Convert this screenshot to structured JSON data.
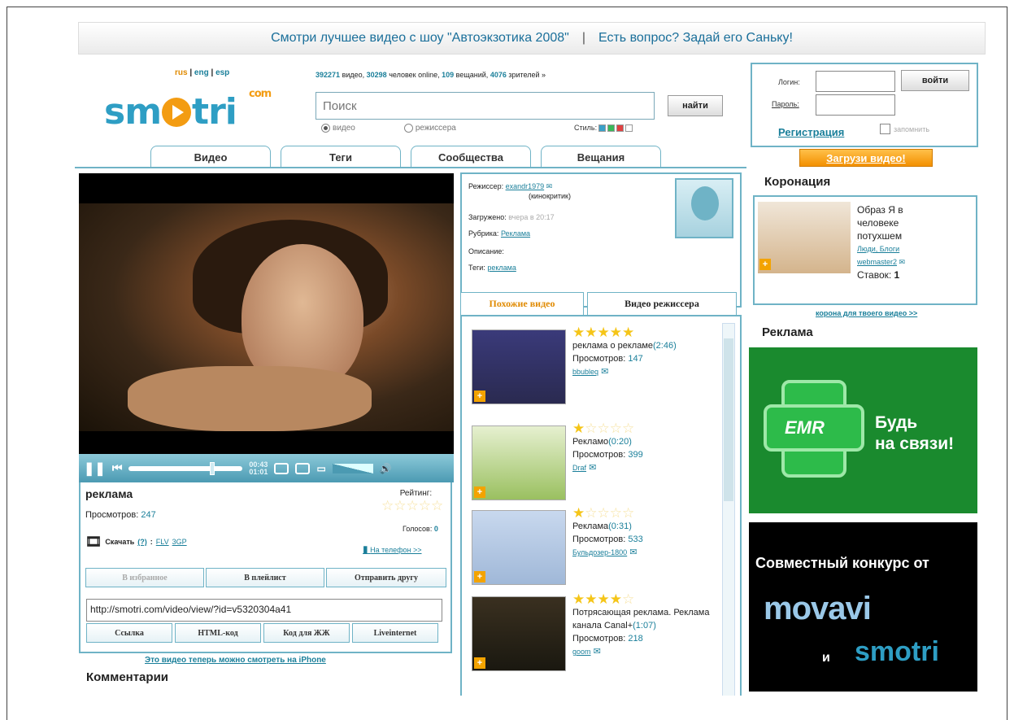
{
  "banner": {
    "left": "Смотри лучшее видео с шоу \"Автоэкзотика 2008\"",
    "sep": "|",
    "right": "Есть вопрос? Задай его Саньку!"
  },
  "langs": [
    "rus",
    "eng",
    "esp"
  ],
  "logo": {
    "text": "sm",
    "text2": "tri",
    "com": "com"
  },
  "stats": {
    "videos": "392271",
    "videos_lbl": "видео,",
    "online": "30298",
    "online_lbl": "человек online,",
    "casts": "109",
    "casts_lbl": "вещаний,",
    "viewers": "4076",
    "viewers_lbl": "зрителей »"
  },
  "search": {
    "placeholder": "Поиск",
    "button": "найти",
    "opt1": "видео",
    "opt2": "режиссера",
    "style_label": "Стиль:"
  },
  "login": {
    "login_label": "Логин:",
    "password_label": "Пароль:",
    "submit": "войти",
    "register": "Регистрация",
    "remember": "запомнить"
  },
  "upload": "Загрузи видео!",
  "tabs": [
    "Видео",
    "Теги",
    "Сообщества",
    "Вещания"
  ],
  "player": {
    "time_current": "00:43",
    "time_total": "01:01"
  },
  "video": {
    "title": "реклама",
    "views_label": "Просмотров:",
    "views": "247",
    "rating_label": "Рейтинг:",
    "votes_label": "Голосов:",
    "votes": "0",
    "download": "Скачать",
    "download_q": "(?)",
    "flv": "FLV",
    "3gp": "3GP",
    "phone": "На телефон >>",
    "btn_fav": "В избранное",
    "btn_playlist": "В плейлист",
    "btn_send": "Отправить другу",
    "url": "http://smotri.com/video/view/?id=v5320304a41",
    "btn_link": "Ссылка",
    "btn_html": "HTML-код",
    "btn_lj": "Код для ЖЖ",
    "btn_li": "Liveinternet"
  },
  "iphone_note": "Это видео теперь можно смотреть на iPhone",
  "comments_title": "Комментарии",
  "director": {
    "label": "Режиссер:",
    "name": "exandr1979",
    "role": "(кинокритик)",
    "uploaded_label": "Загружено:",
    "uploaded": "вчера в 20:17",
    "rubric_label": "Рубрика:",
    "rubric": "Реклама",
    "desc_label": "Описание:",
    "tags_label": "Теги:",
    "tags": "реклама"
  },
  "vtabs": [
    "Похожие видео",
    "Видео режиссера"
  ],
  "similar": [
    {
      "title": "реклама о рекламе",
      "dur": "(2:46)",
      "views_label": "Просмотров:",
      "views": "147",
      "user": "bbubleq",
      "stars": 5
    },
    {
      "title": "Рекламо",
      "dur": "(0:20)",
      "views_label": "Просмотров:",
      "views": "399",
      "user": "Draf",
      "stars": 1
    },
    {
      "title": "Реклама",
      "dur": "(0:31)",
      "views_label": "Просмотров:",
      "views": "533",
      "user": "Бульдозер-1800",
      "stars": 1
    },
    {
      "title": "Потрясающая реклама. Реклама канала Canal+",
      "dur": "(1:07)",
      "views_label": "Просмотров:",
      "views": "218",
      "user": "goom",
      "stars": 4
    }
  ],
  "korona": {
    "title": "Коронация",
    "text": "Образ Я в человеке потухшем",
    "cat": "Люди, Блоги",
    "user": "webmaster2",
    "bets_label": "Ставок:",
    "bets": "1",
    "note": "корона для твоего видео >>"
  },
  "ads": {
    "title": "Реклама",
    "emr": "EMR",
    "slogan1": "Будь",
    "slogan2": "на связи!",
    "contest": "Совместный конкурс от",
    "movavi": "movavi",
    "and": "и",
    "smotri": "smotri"
  }
}
